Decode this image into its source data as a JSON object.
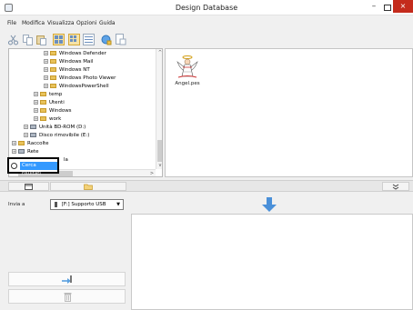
{
  "window": {
    "title": "Design Database",
    "minimize_label": "–",
    "close_label": "×"
  },
  "menu": [
    "File",
    "Modifica",
    "Visualizza",
    "Opzioni",
    "Guida"
  ],
  "toolbar": {
    "buttons": [
      "cut-icon",
      "copy-icon",
      "paste-icon",
      "large-thumbnails-icon",
      "medium-thumbnails-icon",
      "details-view-icon",
      "refresh-icon",
      "properties-icon"
    ]
  },
  "tree": {
    "items": [
      {
        "label": "Windows Defender",
        "level": 3
      },
      {
        "label": "Windows Mail",
        "level": 3
      },
      {
        "label": "Windows NT",
        "level": 3
      },
      {
        "label": "Windows Photo Viewer",
        "level": 3
      },
      {
        "label": "WindowsPowerShell",
        "level": 3
      },
      {
        "label": "temp",
        "level": 2
      },
      {
        "label": "Utenti",
        "level": 2
      },
      {
        "label": "Windows",
        "level": 2
      },
      {
        "label": "work",
        "level": 2
      },
      {
        "label": "Unità BD-ROM (D:)",
        "level": 1
      },
      {
        "label": "Disco rimovibile (E:)",
        "level": 1
      },
      {
        "label": "Raccolte",
        "level": 0
      },
      {
        "label": "Rete",
        "level": 0
      },
      {
        "label": "la",
        "level": 1
      }
    ],
    "search_results_label": "Cerca risultati"
  },
  "files": [
    {
      "name": "Angel.pes"
    }
  ],
  "bottom": {
    "send_to_label": "Invia a",
    "destination": "[F:] Supporto USB"
  }
}
